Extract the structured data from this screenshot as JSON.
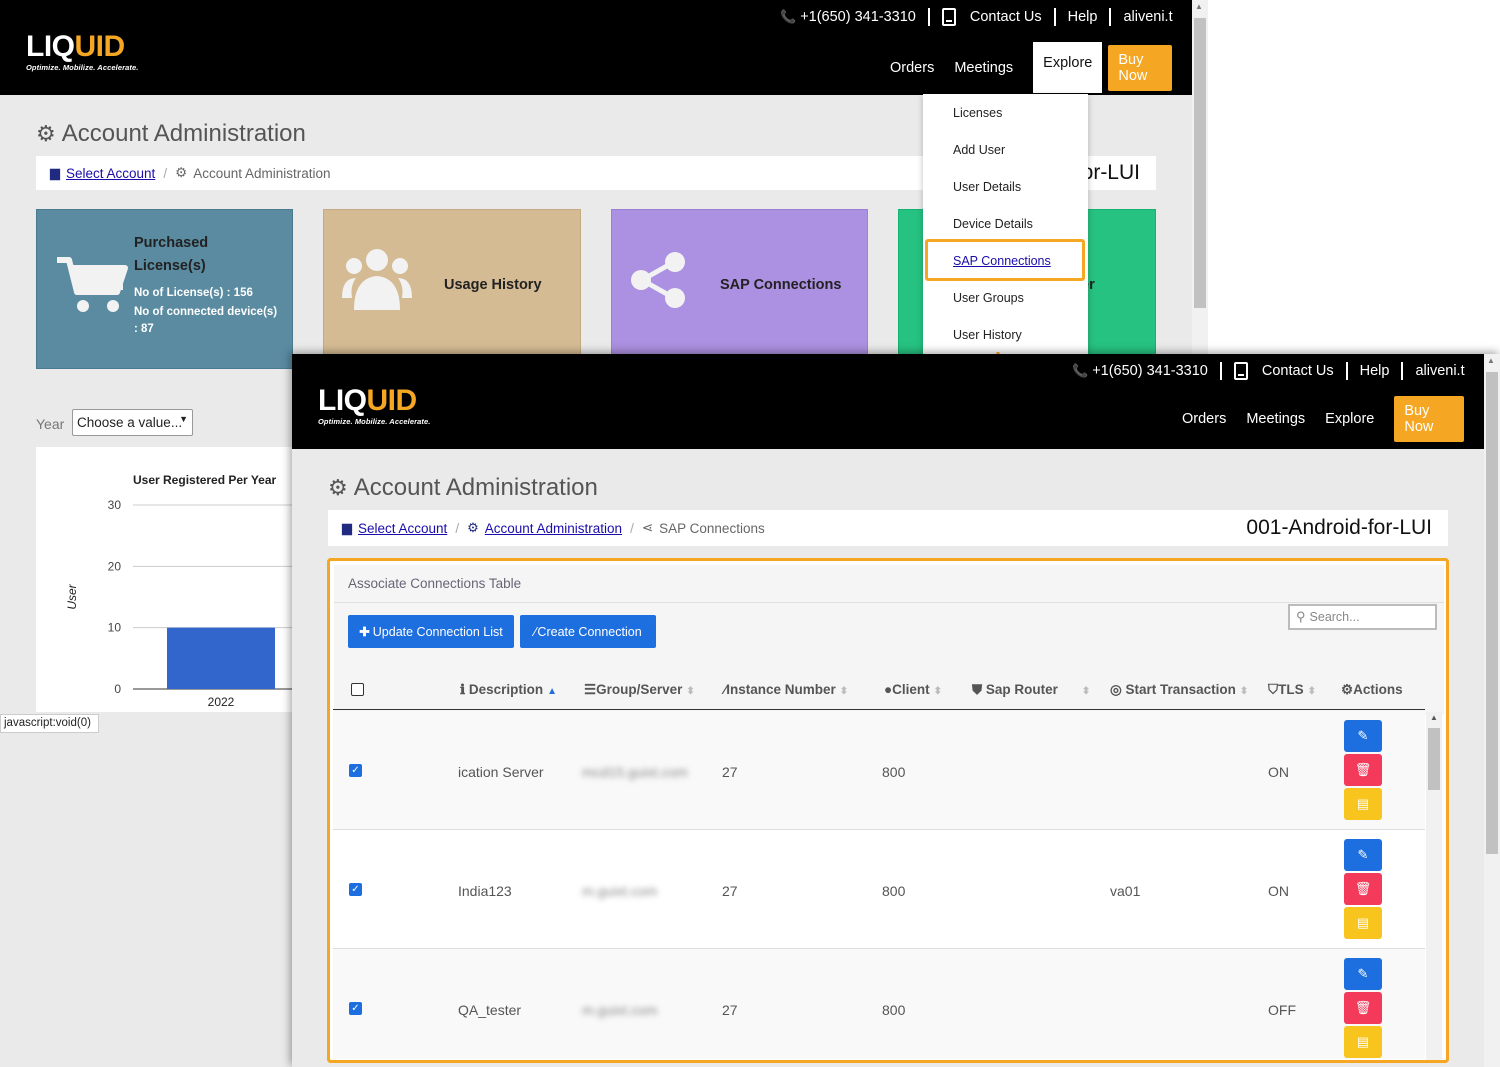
{
  "header": {
    "phone": "+1(650) 341-3310",
    "contact": "Contact Us",
    "help": "Help",
    "user": "aliveni.t",
    "nav": [
      "Orders",
      "Meetings",
      "Explore"
    ],
    "buy_now": "Buy Now",
    "logo_word_a": "LIQ",
    "logo_word_b": "UID",
    "logo_tagline": "Optimize. Mobilize. Accelerate."
  },
  "background": {
    "page_title": "Account Administration",
    "breadcrumb": {
      "select_account": "Select Account",
      "current": "Account Administration"
    },
    "account_name_partial": "or-LUI",
    "tiles": {
      "licenses": {
        "title": "Purchased License(s)",
        "line1": "No of License(s) : 156",
        "line2": "No of connected device(s) : 87"
      },
      "usage": "Usage History",
      "sap": "SAP Connections",
      "fourth_partial": "er"
    },
    "year_label": "Year",
    "year_select": "Choose a value...",
    "status_text": "javascript:void(0)",
    "explore_menu": [
      "Licenses",
      "Add User",
      "User Details",
      "Device Details",
      "SAP Connections",
      "User Groups",
      "User History"
    ]
  },
  "chart_data": {
    "type": "bar",
    "title": "User Registered Per Year",
    "ylabel": "User",
    "categories": [
      "2022"
    ],
    "values": [
      10
    ],
    "ylim": [
      0,
      30
    ],
    "yticks": [
      0,
      10,
      20,
      30
    ],
    "bar_color": "#3366cc"
  },
  "foreground": {
    "page_title": "Account Administration",
    "breadcrumb": {
      "select_account": "Select Account",
      "account_admin": "Account Administration",
      "current": "SAP Connections"
    },
    "account_name": "001-Android-for-LUI",
    "panel_title": "Associate Connections Table",
    "btn_update": "Update Connection List",
    "btn_create": "Create Connection",
    "search_placeholder": "Search...",
    "columns": [
      "Description",
      "Group/Server",
      "Instance Number",
      "Client",
      "Sap Router",
      "Start Transaction",
      "TLS",
      "Actions"
    ],
    "rows": [
      {
        "description": "ication Server",
        "group_server": "mcd15.guixt.com",
        "instance": "27",
        "client": "800",
        "sap_router": "",
        "start_tx": "",
        "tls": "ON"
      },
      {
        "description": "India123",
        "group_server": "m.guixt.com",
        "instance": "27",
        "client": "800",
        "sap_router": "",
        "start_tx": "va01",
        "tls": "ON"
      },
      {
        "description": "QA_tester",
        "group_server": "m.guixt.com",
        "instance": "27",
        "client": "800",
        "sap_router": "",
        "start_tx": "",
        "tls": "OFF"
      }
    ]
  },
  "colors": {
    "accent": "#f5a623",
    "primary": "#1d6fe0",
    "danger": "#f43a5a",
    "warning": "#f7c51e"
  }
}
